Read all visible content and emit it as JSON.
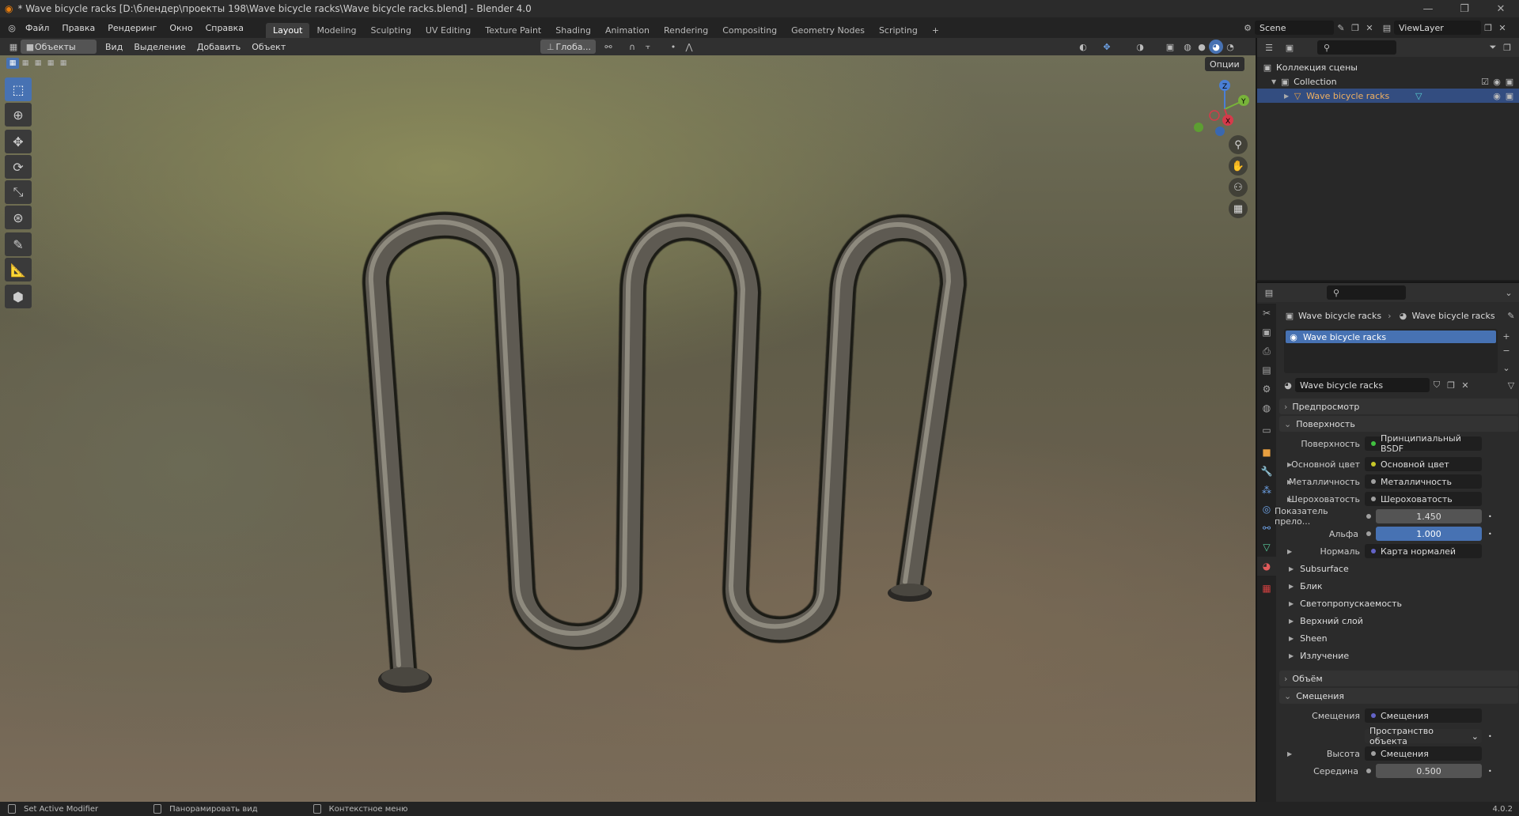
{
  "title": "* Wave bicycle racks [D:\\блендер\\проекты 198\\Wave bicycle racks\\Wave bicycle racks.blend] - Blender 4.0",
  "window_controls": [
    "—",
    "❐",
    "✕"
  ],
  "menus": [
    "Файл",
    "Правка",
    "Рендеринг",
    "Окно",
    "Справка"
  ],
  "workspaces": [
    "Layout",
    "Modeling",
    "Sculpting",
    "UV Editing",
    "Texture Paint",
    "Shading",
    "Animation",
    "Rendering",
    "Compositing",
    "Geometry Nodes",
    "Scripting",
    "+"
  ],
  "scene_name": "Scene",
  "view_layer": "ViewLayer",
  "viewport": {
    "mode": "Объекты",
    "menus": [
      "Вид",
      "Выделение",
      "Добавить",
      "Объект"
    ],
    "transform": "Глоба...",
    "options": "Опции"
  },
  "gizmo": {
    "x": "X",
    "y": "Y",
    "z": "Z"
  },
  "outliner": {
    "root": "Коллекция сцены",
    "collection": "Collection",
    "object": "Wave bicycle racks"
  },
  "properties": {
    "breadcrumb_obj": "Wave bicycle racks",
    "breadcrumb_mat": "Wave bicycle racks",
    "slot": "Wave bicycle racks",
    "material": "Wave bicycle racks",
    "sections": {
      "preview": "Предпросмотр",
      "surface": "Поверхность",
      "volume": "Объём",
      "displacement": "Смещения"
    },
    "surface_label": "Поверхность",
    "surface_value": "Принципиальный BSDF",
    "base_color_label": "Основной цвет",
    "base_color_value": "Основной цвет",
    "metal_label": "Металличность",
    "metal_value": "Металличность",
    "rough_label": "Шероховатость",
    "rough_value": "Шероховатость",
    "ior_label": "Показатель прело...",
    "ior_value": "1.450",
    "alpha_label": "Альфа",
    "alpha_value": "1.000",
    "normal_label": "Нормаль",
    "normal_value": "Карта нормалей",
    "subpanels": [
      "Subsurface",
      "Блик",
      "Светопропускаемость",
      "Верхний слой",
      "Sheen",
      "Излучение"
    ],
    "disp_label": "Смещения",
    "disp_value": "Смещения",
    "space_value": "Пространство объекта",
    "height_label": "Высота",
    "height_value": "Смещения",
    "mid_label": "Середина",
    "mid_value": "0.500"
  },
  "status": {
    "a": "Set Active Modifier",
    "b": "Панорамировать вид",
    "c": "Контекстное меню",
    "version": "4.0.2"
  }
}
